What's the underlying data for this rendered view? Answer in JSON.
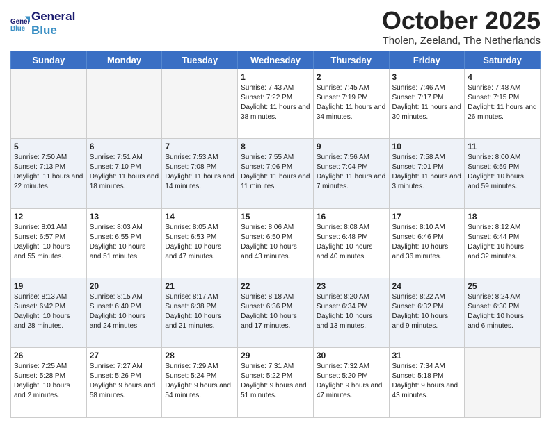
{
  "header": {
    "logo_line1": "General",
    "logo_line2": "Blue",
    "month": "October 2025",
    "location": "Tholen, Zeeland, The Netherlands"
  },
  "weekdays": [
    "Sunday",
    "Monday",
    "Tuesday",
    "Wednesday",
    "Thursday",
    "Friday",
    "Saturday"
  ],
  "weeks": [
    [
      {
        "day": "",
        "sunrise": "",
        "sunset": "",
        "daylight": "",
        "empty": true
      },
      {
        "day": "",
        "sunrise": "",
        "sunset": "",
        "daylight": "",
        "empty": true
      },
      {
        "day": "",
        "sunrise": "",
        "sunset": "",
        "daylight": "",
        "empty": true
      },
      {
        "day": "1",
        "sunrise": "Sunrise: 7:43 AM",
        "sunset": "Sunset: 7:22 PM",
        "daylight": "Daylight: 11 hours and 38 minutes.",
        "empty": false
      },
      {
        "day": "2",
        "sunrise": "Sunrise: 7:45 AM",
        "sunset": "Sunset: 7:19 PM",
        "daylight": "Daylight: 11 hours and 34 minutes.",
        "empty": false
      },
      {
        "day": "3",
        "sunrise": "Sunrise: 7:46 AM",
        "sunset": "Sunset: 7:17 PM",
        "daylight": "Daylight: 11 hours and 30 minutes.",
        "empty": false
      },
      {
        "day": "4",
        "sunrise": "Sunrise: 7:48 AM",
        "sunset": "Sunset: 7:15 PM",
        "daylight": "Daylight: 11 hours and 26 minutes.",
        "empty": false
      }
    ],
    [
      {
        "day": "5",
        "sunrise": "Sunrise: 7:50 AM",
        "sunset": "Sunset: 7:13 PM",
        "daylight": "Daylight: 11 hours and 22 minutes.",
        "empty": false
      },
      {
        "day": "6",
        "sunrise": "Sunrise: 7:51 AM",
        "sunset": "Sunset: 7:10 PM",
        "daylight": "Daylight: 11 hours and 18 minutes.",
        "empty": false
      },
      {
        "day": "7",
        "sunrise": "Sunrise: 7:53 AM",
        "sunset": "Sunset: 7:08 PM",
        "daylight": "Daylight: 11 hours and 14 minutes.",
        "empty": false
      },
      {
        "day": "8",
        "sunrise": "Sunrise: 7:55 AM",
        "sunset": "Sunset: 7:06 PM",
        "daylight": "Daylight: 11 hours and 11 minutes.",
        "empty": false
      },
      {
        "day": "9",
        "sunrise": "Sunrise: 7:56 AM",
        "sunset": "Sunset: 7:04 PM",
        "daylight": "Daylight: 11 hours and 7 minutes.",
        "empty": false
      },
      {
        "day": "10",
        "sunrise": "Sunrise: 7:58 AM",
        "sunset": "Sunset: 7:01 PM",
        "daylight": "Daylight: 11 hours and 3 minutes.",
        "empty": false
      },
      {
        "day": "11",
        "sunrise": "Sunrise: 8:00 AM",
        "sunset": "Sunset: 6:59 PM",
        "daylight": "Daylight: 10 hours and 59 minutes.",
        "empty": false
      }
    ],
    [
      {
        "day": "12",
        "sunrise": "Sunrise: 8:01 AM",
        "sunset": "Sunset: 6:57 PM",
        "daylight": "Daylight: 10 hours and 55 minutes.",
        "empty": false
      },
      {
        "day": "13",
        "sunrise": "Sunrise: 8:03 AM",
        "sunset": "Sunset: 6:55 PM",
        "daylight": "Daylight: 10 hours and 51 minutes.",
        "empty": false
      },
      {
        "day": "14",
        "sunrise": "Sunrise: 8:05 AM",
        "sunset": "Sunset: 6:53 PM",
        "daylight": "Daylight: 10 hours and 47 minutes.",
        "empty": false
      },
      {
        "day": "15",
        "sunrise": "Sunrise: 8:06 AM",
        "sunset": "Sunset: 6:50 PM",
        "daylight": "Daylight: 10 hours and 43 minutes.",
        "empty": false
      },
      {
        "day": "16",
        "sunrise": "Sunrise: 8:08 AM",
        "sunset": "Sunset: 6:48 PM",
        "daylight": "Daylight: 10 hours and 40 minutes.",
        "empty": false
      },
      {
        "day": "17",
        "sunrise": "Sunrise: 8:10 AM",
        "sunset": "Sunset: 6:46 PM",
        "daylight": "Daylight: 10 hours and 36 minutes.",
        "empty": false
      },
      {
        "day": "18",
        "sunrise": "Sunrise: 8:12 AM",
        "sunset": "Sunset: 6:44 PM",
        "daylight": "Daylight: 10 hours and 32 minutes.",
        "empty": false
      }
    ],
    [
      {
        "day": "19",
        "sunrise": "Sunrise: 8:13 AM",
        "sunset": "Sunset: 6:42 PM",
        "daylight": "Daylight: 10 hours and 28 minutes.",
        "empty": false
      },
      {
        "day": "20",
        "sunrise": "Sunrise: 8:15 AM",
        "sunset": "Sunset: 6:40 PM",
        "daylight": "Daylight: 10 hours and 24 minutes.",
        "empty": false
      },
      {
        "day": "21",
        "sunrise": "Sunrise: 8:17 AM",
        "sunset": "Sunset: 6:38 PM",
        "daylight": "Daylight: 10 hours and 21 minutes.",
        "empty": false
      },
      {
        "day": "22",
        "sunrise": "Sunrise: 8:18 AM",
        "sunset": "Sunset: 6:36 PM",
        "daylight": "Daylight: 10 hours and 17 minutes.",
        "empty": false
      },
      {
        "day": "23",
        "sunrise": "Sunrise: 8:20 AM",
        "sunset": "Sunset: 6:34 PM",
        "daylight": "Daylight: 10 hours and 13 minutes.",
        "empty": false
      },
      {
        "day": "24",
        "sunrise": "Sunrise: 8:22 AM",
        "sunset": "Sunset: 6:32 PM",
        "daylight": "Daylight: 10 hours and 9 minutes.",
        "empty": false
      },
      {
        "day": "25",
        "sunrise": "Sunrise: 8:24 AM",
        "sunset": "Sunset: 6:30 PM",
        "daylight": "Daylight: 10 hours and 6 minutes.",
        "empty": false
      }
    ],
    [
      {
        "day": "26",
        "sunrise": "Sunrise: 7:25 AM",
        "sunset": "Sunset: 5:28 PM",
        "daylight": "Daylight: 10 hours and 2 minutes.",
        "empty": false
      },
      {
        "day": "27",
        "sunrise": "Sunrise: 7:27 AM",
        "sunset": "Sunset: 5:26 PM",
        "daylight": "Daylight: 9 hours and 58 minutes.",
        "empty": false
      },
      {
        "day": "28",
        "sunrise": "Sunrise: 7:29 AM",
        "sunset": "Sunset: 5:24 PM",
        "daylight": "Daylight: 9 hours and 54 minutes.",
        "empty": false
      },
      {
        "day": "29",
        "sunrise": "Sunrise: 7:31 AM",
        "sunset": "Sunset: 5:22 PM",
        "daylight": "Daylight: 9 hours and 51 minutes.",
        "empty": false
      },
      {
        "day": "30",
        "sunrise": "Sunrise: 7:32 AM",
        "sunset": "Sunset: 5:20 PM",
        "daylight": "Daylight: 9 hours and 47 minutes.",
        "empty": false
      },
      {
        "day": "31",
        "sunrise": "Sunrise: 7:34 AM",
        "sunset": "Sunset: 5:18 PM",
        "daylight": "Daylight: 9 hours and 43 minutes.",
        "empty": false
      },
      {
        "day": "",
        "sunrise": "",
        "sunset": "",
        "daylight": "",
        "empty": true
      }
    ]
  ]
}
